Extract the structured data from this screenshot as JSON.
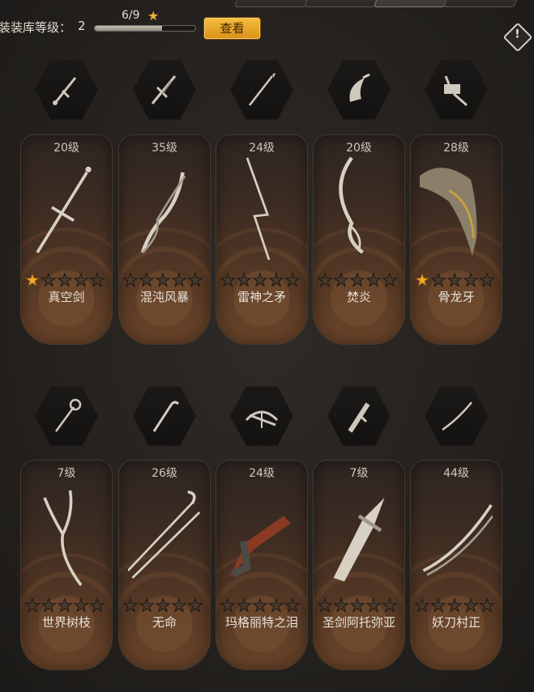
{
  "header": {
    "level_label": "装装库等级：",
    "level_value": "2",
    "progress_text": "6/9",
    "progress_fraction": 0.667,
    "view_button": "查看"
  },
  "weapons_row1": [
    {
      "level": "20级",
      "name": "真空剑",
      "stars": 1,
      "icon": "sword-icon"
    },
    {
      "level": "35级",
      "name": "混沌风暴",
      "stars": 0,
      "icon": "twisted-sword-icon"
    },
    {
      "level": "24级",
      "name": "雷神之矛",
      "stars": 0,
      "icon": "spear-icon"
    },
    {
      "level": "20级",
      "name": "焚炎",
      "stars": 0,
      "icon": "curved-blade-icon"
    },
    {
      "level": "28级",
      "name": "骨龙牙",
      "stars": 1,
      "icon": "hammer-icon"
    }
  ],
  "weapons_row2": [
    {
      "level": "7级",
      "name": "世界树枝",
      "stars": 0,
      "icon": "staff-icon"
    },
    {
      "level": "26级",
      "name": "无命",
      "stars": 0,
      "icon": "cane-icon"
    },
    {
      "level": "24级",
      "name": "玛格丽特之泪",
      "stars": 0,
      "icon": "crossbow-icon"
    },
    {
      "level": "7级",
      "name": "圣剑阿托弥亚",
      "stars": 0,
      "icon": "greatsword-icon"
    },
    {
      "level": "44级",
      "name": "妖刀村正",
      "stars": 0,
      "icon": "katana-icon"
    }
  ]
}
